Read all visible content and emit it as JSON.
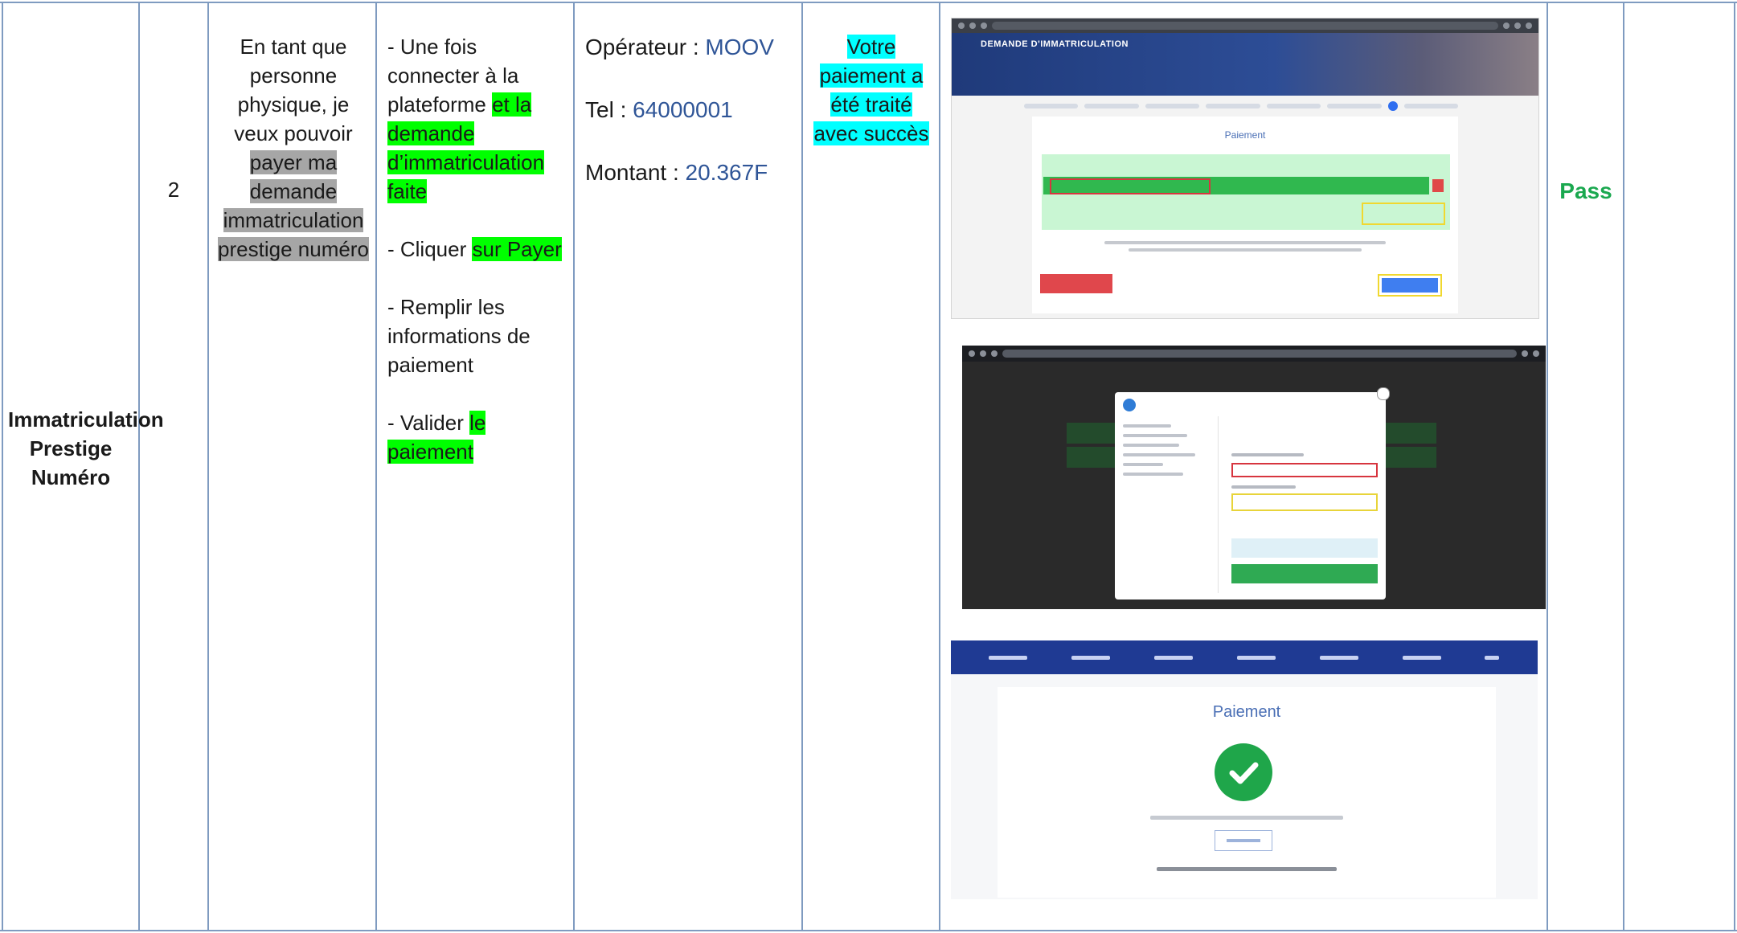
{
  "row": {
    "module": "Immatriculation Prestige Numéro",
    "number": "2",
    "user_story": {
      "plain": "En tant que personne physique, je veux pouvoir",
      "highlighted": "payer ma demande immatriculation prestige numéro"
    },
    "steps": {
      "s1_plain": "- Une fois connecter à la plateforme",
      "s1_hl": "et la demande d’immatriculation faite",
      "s2_plain": "- Cliquer",
      "s2_hl": "sur Payer",
      "s3": "-  Remplir les informations de paiement",
      "s4_plain": "- Valider",
      "s4_hl": "le paiement"
    },
    "data": {
      "operator_label": "Opérateur :",
      "operator_value": "MOOV",
      "tel_label": "Tel :",
      "tel_value": "64000001",
      "amount_label": "Montant :",
      "amount_value": "20.367F"
    },
    "expected_result": "Votre paiement a été traité avec succès",
    "status": "Pass"
  },
  "screens": {
    "s1": {
      "banner_title": "DEMANDE D'IMMATRICULATION",
      "panel_title": "Paiement"
    },
    "s3": {
      "title": "Paiement"
    }
  },
  "colors": {
    "grid": "#7f9bc0",
    "green_highlight": "#00ff00",
    "grey_highlight": "#a6a6a6",
    "cyan_highlight": "#00ffff",
    "pass": "#1aa84f",
    "value_blue": "#2f5597"
  }
}
